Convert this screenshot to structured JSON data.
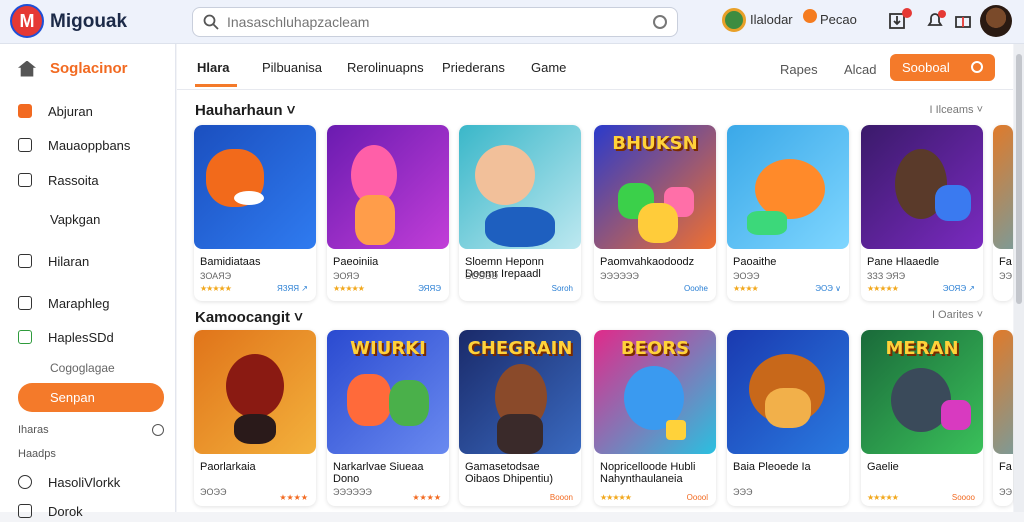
{
  "header": {
    "brand": "Migouak",
    "search_placeholder": "Inasaschluhapzacleam",
    "user1_label": "Ilalodar",
    "user2_label": "Pecao"
  },
  "sidebar": {
    "home_label": "Soglacinor",
    "items": [
      {
        "label": "Abjuran",
        "icon": "grid-icon"
      },
      {
        "label": "Mauaoppbans",
        "icon": "file-icon"
      },
      {
        "label": "Rassoita",
        "icon": "square-icon"
      },
      {
        "label": "Vapkgan",
        "icon": ""
      },
      {
        "label": "Hilaran",
        "icon": "check-icon"
      },
      {
        "label": "Maraphleg",
        "icon": "folder-icon"
      },
      {
        "label": "HaplesSDd",
        "icon": "checkbox-icon"
      },
      {
        "label": "Cogoglagae",
        "icon": ""
      }
    ],
    "active_label": "Senpan",
    "section_label": "Iharas",
    "section2_label": "Haadps",
    "bottom_items": [
      "HasoliVlorkk",
      "Dorok"
    ]
  },
  "tabs": {
    "items": [
      "Hlara",
      "Pilbuanisa",
      "Rerolinuapns",
      "Priederans",
      "Game"
    ],
    "right_links": [
      "Rapes",
      "Alcad"
    ],
    "button_label": "Sooboal"
  },
  "sections": [
    {
      "title": "Hauharhaun",
      "more": "I Ilceams",
      "cards": [
        {
          "name": "Bamidiataas",
          "meta": "ЗОАЯЭ",
          "stars": "★★★★★",
          "tag": "ЯЗЯЯ ↗",
          "art": "orange-monster"
        },
        {
          "name": "Paeoiniia",
          "meta": "ЭОЯЭ",
          "stars": "★★★★★",
          "tag": "ЭЯЯЭ",
          "art": "pink-hero"
        },
        {
          "name": "Sloemn Heponn Doomr Irepaadl",
          "meta": "ЭОЭЭЭ",
          "stars": "",
          "tag": "Soroh",
          "art": "boy"
        },
        {
          "name": "Paomvahkaodoodz",
          "meta": "ЭЭЭЭЭЭ",
          "stars": "",
          "tag": "Ooohe",
          "art": "bubble-title"
        },
        {
          "name": "Paoaithe",
          "meta": "ЭОЭЭ",
          "stars": "★★★★",
          "tag": "ЭОЭ ∨",
          "art": "bird"
        },
        {
          "name": "Pane Hlaaedle",
          "meta": "ЗЗЗ ЭЯЭ",
          "stars": "★★★★★",
          "tag": "ЭОЯЭ ↗",
          "art": "hero"
        },
        {
          "name": "Fa",
          "meta": "ЭЭ",
          "stars": "",
          "tag": "",
          "art": "partial"
        }
      ]
    },
    {
      "title": "Kamoocangit",
      "more": "I Oarites",
      "cards": [
        {
          "name": "Paorlarkaia",
          "meta": "ЭОЭЭ",
          "stars": "",
          "tag": "★★★★",
          "art": "spider"
        },
        {
          "name": "Narkarlvae Siueaa Dono",
          "meta": "ЭЭЭЭЭЭ",
          "stars": "",
          "tag": "★★★★",
          "art": "wiurki"
        },
        {
          "name": "Gamasetodsae Oibaos Dhipentiu)",
          "meta": "",
          "stars": "",
          "tag": "Booon",
          "art": "chegain"
        },
        {
          "name": "Nopricelloode Hubli Nahynthaulaneia",
          "meta": "",
          "stars": "★★★★★",
          "tag": "Ooool",
          "art": "blue-monster"
        },
        {
          "name": "Baia Pleoede Ia",
          "meta": "ЭЭЭ",
          "stars": "",
          "tag": "",
          "art": "lion"
        },
        {
          "name": "Gaelie",
          "meta": "",
          "stars": "★★★★★",
          "tag": "Soooo",
          "art": "meran"
        },
        {
          "name": "Fa",
          "meta": "ЭЭ",
          "stars": "",
          "tag": "",
          "art": "partial"
        }
      ]
    }
  ],
  "art_titles": {
    "bubble-title": "BHUKSN",
    "wiurki": "WIURKI",
    "chegain": "CHEGRAIN",
    "blue-monster": "BEORS",
    "meran": "MERAN"
  },
  "colors": {
    "accent": "#f47a2a",
    "brand_red": "#e53935",
    "brand_blue": "#1e4fd6"
  }
}
